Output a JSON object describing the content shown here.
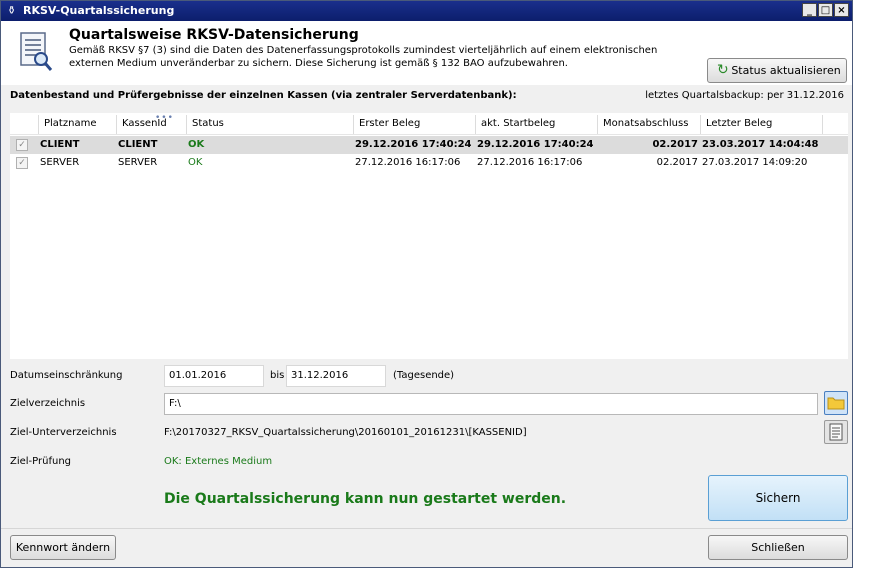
{
  "window": {
    "title": "RKSV-Quartalssicherung",
    "controls": {
      "minimize": "_",
      "maximize": "□",
      "close": "×"
    }
  },
  "header": {
    "title": "Quartalsweise RKSV-Datensicherung",
    "desc_line1": "Gemäß RKSV §7 (3) sind die Daten des Datenerfassungsprotokolls zumindest vierteljährlich auf einem elektronischen",
    "desc_line2": "externen Medium unveränderbar zu sichern. Diese Sicherung ist gemäß § 132 BAO aufzubewahren.",
    "status_button": "Status aktualisieren"
  },
  "section": {
    "label": "Datenbestand und Prüfergebnisse der einzelnen Kassen (via zentraler Serverdatenbank):",
    "last_backup": "letztes Quartalsbackup: per 31.12.2016"
  },
  "grid": {
    "columns": [
      "Platzname",
      "KassenId",
      "Status",
      "Erster Beleg",
      "akt. Startbeleg",
      "Monatsabschluss",
      "Letzter Beleg"
    ],
    "rows": [
      {
        "checked": true,
        "platzname": "CLIENT",
        "kassenid": "CLIENT",
        "status": "OK",
        "erster_beleg": "29.12.2016 17:40:24",
        "akt_startbeleg": "29.12.2016 17:40:24",
        "monatsabschluss": "02.2017",
        "letzter_beleg": "23.03.2017 14:04:48"
      },
      {
        "checked": true,
        "platzname": "SERVER",
        "kassenid": "SERVER",
        "status": "OK",
        "erster_beleg": "27.12.2016 16:17:06",
        "akt_startbeleg": "27.12.2016 16:17:06",
        "monatsabschluss": "02.2017",
        "letzter_beleg": "27.03.2017 14:09:20"
      }
    ]
  },
  "form": {
    "date_label": "Datumseinschränkung",
    "date_from": "01.01.2016",
    "bis": "bis",
    "date_to": "31.12.2016",
    "tagesende": "(Tagesende)",
    "target_dir_label": "Zielverzeichnis",
    "target_dir": "F:\\",
    "subdir_label": "Ziel-Unterverzeichnis",
    "subdir": "F:\\20170327_RKSV_Quartalssicherung\\20160101_20161231\\[KASSENID]",
    "check_label": "Ziel-Prüfung",
    "check_value": "OK: Externes Medium"
  },
  "message": "Die Quartalssicherung kann nun gestartet werden.",
  "buttons": {
    "sichern": "Sichern",
    "kennwort": "Kennwort ändern",
    "schliessen": "Schließen"
  },
  "colors": {
    "title_bar": "#12278a",
    "ok_green": "#1a7a1a",
    "selected_row": "#dcdcdc",
    "primary_button": "#c2e0f6"
  }
}
